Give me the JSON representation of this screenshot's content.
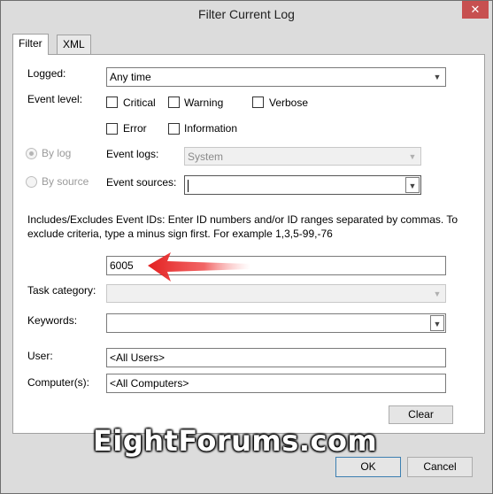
{
  "window": {
    "title": "Filter Current Log",
    "close_glyph": "✕"
  },
  "tabs": [
    {
      "label": "Filter",
      "active": true
    },
    {
      "label": "XML",
      "active": false
    }
  ],
  "filter": {
    "logged_label": "Logged:",
    "logged_value": "Any time",
    "event_level_label": "Event level:",
    "levels": [
      {
        "label": "Critical",
        "checked": false
      },
      {
        "label": "Warning",
        "checked": false
      },
      {
        "label": "Verbose",
        "checked": false
      },
      {
        "label": "Error",
        "checked": false
      },
      {
        "label": "Information",
        "checked": false
      }
    ],
    "by_log_label": "By log",
    "by_source_label": "By source",
    "event_logs_label": "Event logs:",
    "event_logs_value": "System",
    "event_sources_label": "Event sources:",
    "event_sources_value": "",
    "ids_help": "Includes/Excludes Event IDs: Enter ID numbers and/or ID ranges separated by commas. To exclude criteria, type a minus sign first. For example 1,3,5-99,-76",
    "event_ids_value": "6005",
    "task_category_label": "Task category:",
    "task_category_value": "",
    "keywords_label": "Keywords:",
    "keywords_value": "",
    "user_label": "User:",
    "user_value": "<All Users>",
    "computer_label": "Computer(s):",
    "computer_value": "<All Computers>",
    "clear_label": "Clear"
  },
  "footer": {
    "ok_label": "OK",
    "cancel_label": "Cancel"
  },
  "watermark": "EightForums.com",
  "colors": {
    "close_red": "#c75050",
    "arrow_red": "#e32020",
    "ok_border": "#3c7fb1"
  }
}
